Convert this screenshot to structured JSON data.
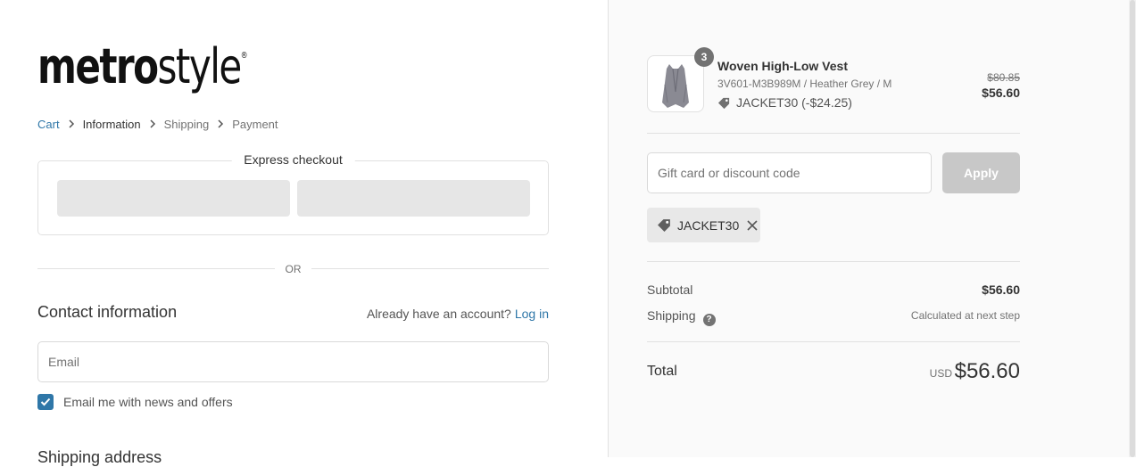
{
  "brand": {
    "logo_bold": "metro",
    "logo_thin": "style",
    "logo_mark": "®"
  },
  "breadcrumb": [
    {
      "label": "Cart",
      "state": "link"
    },
    {
      "label": "Information",
      "state": "current"
    },
    {
      "label": "Shipping",
      "state": "upcoming"
    },
    {
      "label": "Payment",
      "state": "upcoming"
    }
  ],
  "express": {
    "title": "Express checkout"
  },
  "divider": {
    "or_label": "OR"
  },
  "contact": {
    "title": "Contact information",
    "account_prompt": "Already have an account?",
    "login_label": "Log in",
    "email_placeholder": "Email",
    "newsletter_label": "Email me with news and offers",
    "newsletter_checked": true
  },
  "shipping": {
    "title": "Shipping address"
  },
  "order": {
    "item": {
      "quantity": "3",
      "name": "Woven High-Low Vest",
      "variant": "3V601-M3B989M / Heather Grey / M",
      "discount_text": "JACKET30 (-$24.25)",
      "original_price": "$80.85",
      "price": "$56.60"
    },
    "discount_input": {
      "placeholder": "Gift card or discount code",
      "apply_label": "Apply"
    },
    "applied_code": "JACKET30",
    "subtotal": {
      "label": "Subtotal",
      "value": "$56.60"
    },
    "shipping": {
      "label": "Shipping",
      "help": "?",
      "value": "Calculated at next step"
    },
    "total": {
      "label": "Total",
      "currency": "USD",
      "value": "$56.60"
    }
  },
  "colors": {
    "link": "#2f77a8",
    "checkbox": "#2f77a8",
    "aside_bg": "#fafafa",
    "apply_disabled": "#c8c8c8"
  }
}
